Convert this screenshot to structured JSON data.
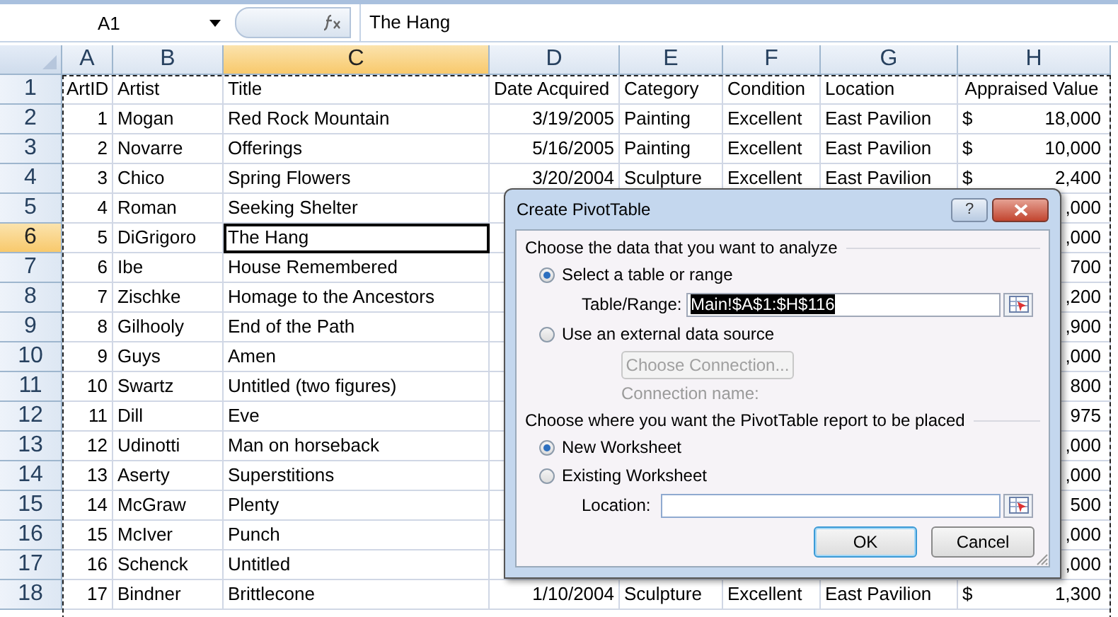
{
  "formula_bar": {
    "name_box": "A1",
    "formula": "The Hang"
  },
  "columns": [
    {
      "label": "A",
      "selected": false,
      "kind": "number"
    },
    {
      "label": "B",
      "selected": false,
      "kind": "text"
    },
    {
      "label": "C",
      "selected": true,
      "kind": "text"
    },
    {
      "label": "D",
      "selected": false,
      "kind": "number"
    },
    {
      "label": "E",
      "selected": false,
      "kind": "text"
    },
    {
      "label": "F",
      "selected": false,
      "kind": "text"
    },
    {
      "label": "G",
      "selected": false,
      "kind": "text"
    },
    {
      "label": "H",
      "selected": false,
      "kind": "number"
    }
  ],
  "rows": [
    {
      "number": "1",
      "selected": false,
      "kind": "header",
      "cells": [
        {
          "text": "ArtID",
          "active": false
        },
        {
          "text": "Artist",
          "active": false
        },
        {
          "text": "Title",
          "active": false
        },
        {
          "text": "Date Acquired",
          "active": false
        },
        {
          "text": "Category",
          "active": false
        },
        {
          "text": "Condition",
          "active": false
        },
        {
          "text": "Location",
          "active": false
        }
      ],
      "value": "Appraised Value"
    },
    {
      "number": "2",
      "selected": false,
      "kind": "data",
      "cells": [
        {
          "text": "1",
          "active": false
        },
        {
          "text": "Mogan",
          "active": false
        },
        {
          "text": "Red Rock Mountain",
          "active": false
        },
        {
          "text": "3/19/2005",
          "active": false
        },
        {
          "text": "Painting",
          "active": false
        },
        {
          "text": "Excellent",
          "active": false
        },
        {
          "text": "East Pavilion",
          "active": false
        }
      ],
      "currency": "$",
      "value": "18,000"
    },
    {
      "number": "3",
      "selected": false,
      "kind": "data",
      "cells": [
        {
          "text": "2",
          "active": false
        },
        {
          "text": "Novarre",
          "active": false
        },
        {
          "text": "Offerings",
          "active": false
        },
        {
          "text": "5/16/2005",
          "active": false
        },
        {
          "text": "Painting",
          "active": false
        },
        {
          "text": "Excellent",
          "active": false
        },
        {
          "text": "East Pavilion",
          "active": false
        }
      ],
      "currency": "$",
      "value": "10,000"
    },
    {
      "number": "4",
      "selected": false,
      "kind": "data",
      "cells": [
        {
          "text": "3",
          "active": false
        },
        {
          "text": "Chico",
          "active": false
        },
        {
          "text": "Spring Flowers",
          "active": false
        },
        {
          "text": "3/20/2004",
          "active": false
        },
        {
          "text": "Sculpture",
          "active": false
        },
        {
          "text": "Excellent",
          "active": false
        },
        {
          "text": "East Pavilion",
          "active": false
        }
      ],
      "currency": "$",
      "value": "2,400"
    },
    {
      "number": "5",
      "selected": false,
      "kind": "data",
      "cells": [
        {
          "text": "4",
          "active": false
        },
        {
          "text": "Roman",
          "active": false
        },
        {
          "text": "Seeking Shelter",
          "active": false
        }
      ],
      "value": ",000"
    },
    {
      "number": "6",
      "selected": true,
      "kind": "data",
      "cells": [
        {
          "text": "5",
          "active": false
        },
        {
          "text": "DiGrigoro",
          "active": false
        },
        {
          "text": "The Hang",
          "active": true
        }
      ],
      "value": ",000"
    },
    {
      "number": "7",
      "selected": false,
      "kind": "data",
      "cells": [
        {
          "text": "6",
          "active": false
        },
        {
          "text": "Ibe",
          "active": false
        },
        {
          "text": "House Remembered",
          "active": false
        }
      ],
      "value": "700"
    },
    {
      "number": "8",
      "selected": false,
      "kind": "data",
      "cells": [
        {
          "text": "7",
          "active": false
        },
        {
          "text": "Zischke",
          "active": false
        },
        {
          "text": "Homage to the Ancestors",
          "active": false
        }
      ],
      "value": ",200"
    },
    {
      "number": "9",
      "selected": false,
      "kind": "data",
      "cells": [
        {
          "text": "8",
          "active": false
        },
        {
          "text": "Gilhooly",
          "active": false
        },
        {
          "text": "End of the Path",
          "active": false
        }
      ],
      "value": ",900"
    },
    {
      "number": "10",
      "selected": false,
      "kind": "data",
      "cells": [
        {
          "text": "9",
          "active": false
        },
        {
          "text": "Guys",
          "active": false
        },
        {
          "text": "Amen",
          "active": false
        }
      ],
      "value": ",000"
    },
    {
      "number": "11",
      "selected": false,
      "kind": "data",
      "cells": [
        {
          "text": "10",
          "active": false
        },
        {
          "text": "Swartz",
          "active": false
        },
        {
          "text": "Untitled (two figures)",
          "active": false
        }
      ],
      "value": "800"
    },
    {
      "number": "12",
      "selected": false,
      "kind": "data",
      "cells": [
        {
          "text": "11",
          "active": false
        },
        {
          "text": "Dill",
          "active": false
        },
        {
          "text": "Eve",
          "active": false
        }
      ],
      "value": "975"
    },
    {
      "number": "13",
      "selected": false,
      "kind": "data",
      "cells": [
        {
          "text": "12",
          "active": false
        },
        {
          "text": "Udinotti",
          "active": false
        },
        {
          "text": "Man on horseback",
          "active": false
        }
      ],
      "value": ",000"
    },
    {
      "number": "14",
      "selected": false,
      "kind": "data",
      "cells": [
        {
          "text": "13",
          "active": false
        },
        {
          "text": "Aserty",
          "active": false
        },
        {
          "text": "Superstitions",
          "active": false
        }
      ],
      "value": ",000"
    },
    {
      "number": "15",
      "selected": false,
      "kind": "data",
      "cells": [
        {
          "text": "14",
          "active": false
        },
        {
          "text": "McGraw",
          "active": false
        },
        {
          "text": "Plenty",
          "active": false
        }
      ],
      "value": "500"
    },
    {
      "number": "16",
      "selected": false,
      "kind": "data",
      "cells": [
        {
          "text": "15",
          "active": false
        },
        {
          "text": "McIver",
          "active": false
        },
        {
          "text": "Punch",
          "active": false
        }
      ],
      "value": ",000"
    },
    {
      "number": "17",
      "selected": false,
      "kind": "data",
      "cells": [
        {
          "text": "16",
          "active": false
        },
        {
          "text": "Schenck",
          "active": false
        },
        {
          "text": "Untitled",
          "active": false
        }
      ],
      "value": ",000"
    },
    {
      "number": "18",
      "selected": false,
      "kind": "data",
      "cells": [
        {
          "text": "17",
          "active": false
        },
        {
          "text": "Bindner",
          "active": false
        },
        {
          "text": "Brittlecone",
          "active": false
        },
        {
          "text": "1/10/2004",
          "active": false
        },
        {
          "text": "Sculpture",
          "active": false
        },
        {
          "text": "Excellent",
          "active": false
        },
        {
          "text": "East Pavilion",
          "active": false
        }
      ],
      "currency": "$",
      "value": "1,300"
    }
  ],
  "dialog": {
    "title": "Create PivotTable",
    "help_button": "?",
    "source_heading": "Choose the data that you want to analyze",
    "source_options": [
      {
        "label": "Select a table or range",
        "selected": true
      },
      {
        "label": "Use an external data source",
        "selected": false
      }
    ],
    "table_range": {
      "label": "Table/Range:",
      "value": "Main!$A$1:$H$116"
    },
    "choose_connection": {
      "label": "Choose Connection...",
      "disabled": true
    },
    "connection_name": {
      "label": "Connection name:",
      "disabled": true
    },
    "placement_heading": "Choose where you want the PivotTable report to be placed",
    "placement_options": [
      {
        "label": "New Worksheet",
        "selected": true
      },
      {
        "label": "Existing Worksheet",
        "selected": false
      }
    ],
    "location": {
      "label": "Location:"
    },
    "buttons": [
      {
        "label": "OK",
        "default": true
      },
      {
        "label": "Cancel",
        "default": false
      }
    ]
  }
}
